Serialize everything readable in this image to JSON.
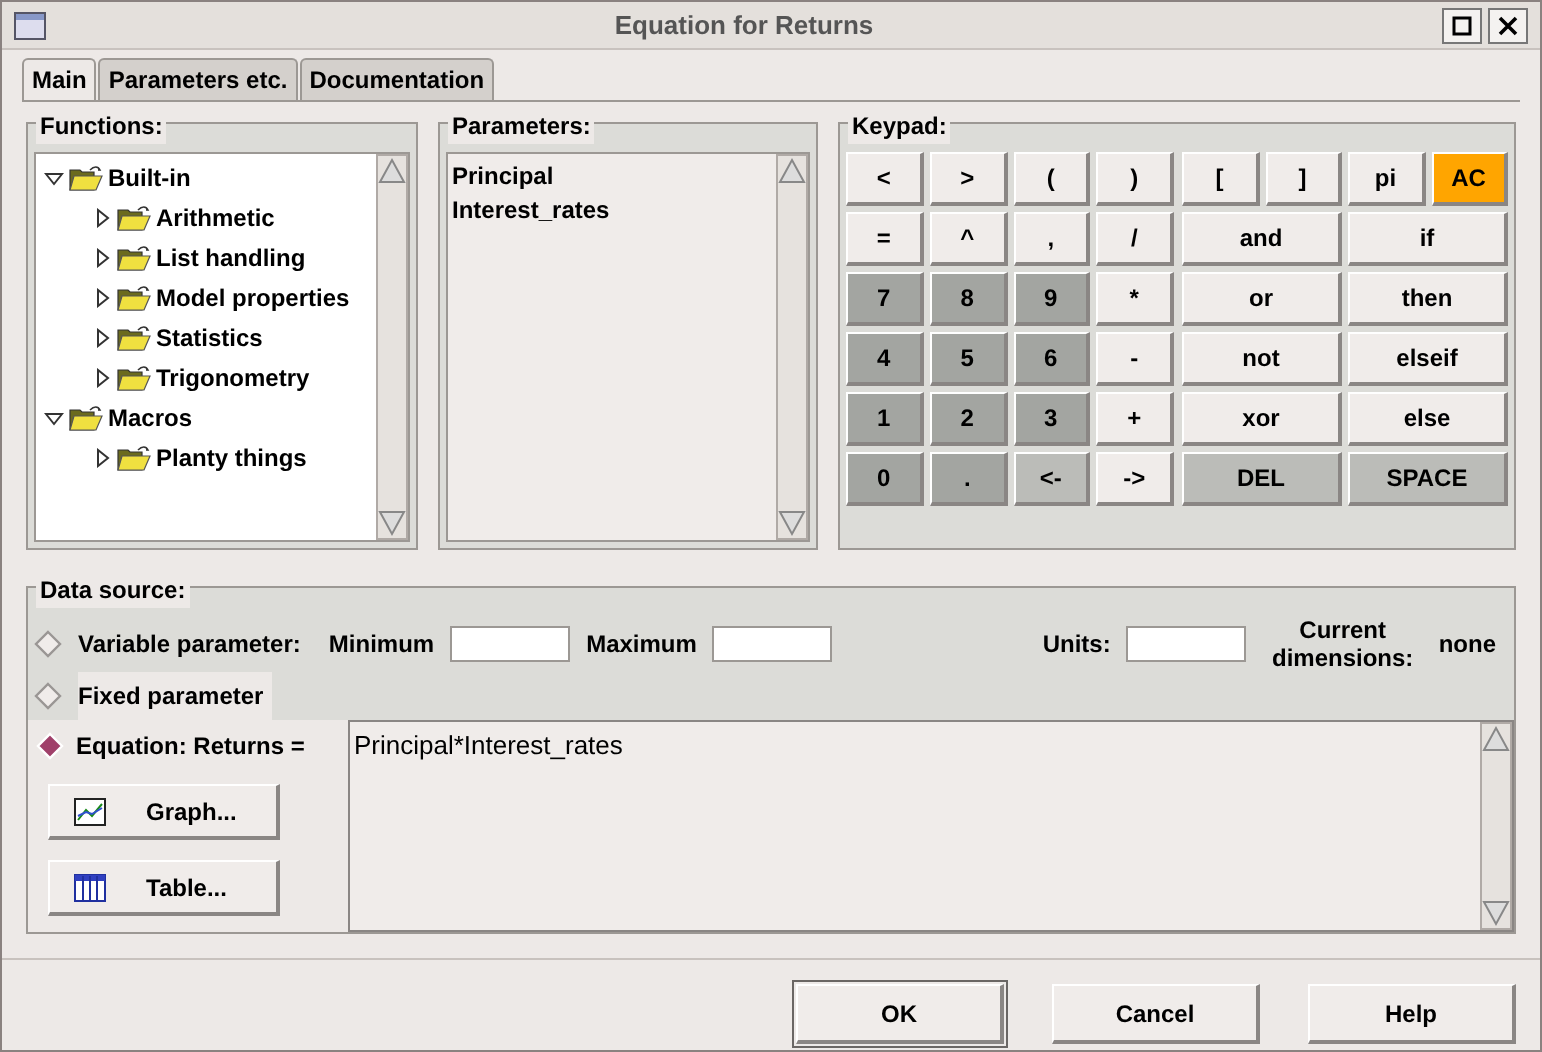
{
  "window": {
    "title": "Equation for Returns"
  },
  "tabs": [
    {
      "label": "Main",
      "selected": true
    },
    {
      "label": "Parameters etc.",
      "selected": false
    },
    {
      "label": "Documentation",
      "selected": false
    }
  ],
  "functions": {
    "title": "Functions:",
    "tree": [
      {
        "label": "Built-in",
        "expanded": true,
        "children": [
          {
            "label": "Arithmetic",
            "expanded": false
          },
          {
            "label": "List handling",
            "expanded": false
          },
          {
            "label": "Model properties",
            "expanded": false
          },
          {
            "label": "Statistics",
            "expanded": false
          },
          {
            "label": "Trigonometry",
            "expanded": false
          }
        ]
      },
      {
        "label": "Macros",
        "expanded": true,
        "children": [
          {
            "label": "Planty things",
            "expanded": false
          }
        ]
      }
    ]
  },
  "parameters": {
    "title": "Parameters:",
    "items": [
      "Principal",
      "Interest_rates"
    ]
  },
  "keypad": {
    "title": "Keypad:",
    "left_keys": [
      {
        "label": "<",
        "kind": "light"
      },
      {
        "label": ">",
        "kind": "light"
      },
      {
        "label": "(",
        "kind": "light"
      },
      {
        "label": ")",
        "kind": "light"
      },
      {
        "label": "=",
        "kind": "light"
      },
      {
        "label": "^",
        "kind": "light"
      },
      {
        "label": ",",
        "kind": "light"
      },
      {
        "label": "/",
        "kind": "light"
      },
      {
        "label": "7",
        "kind": "dark"
      },
      {
        "label": "8",
        "kind": "dark"
      },
      {
        "label": "9",
        "kind": "dark"
      },
      {
        "label": "*",
        "kind": "light"
      },
      {
        "label": "4",
        "kind": "dark"
      },
      {
        "label": "5",
        "kind": "dark"
      },
      {
        "label": "6",
        "kind": "dark"
      },
      {
        "label": "-",
        "kind": "light"
      },
      {
        "label": "1",
        "kind": "dark"
      },
      {
        "label": "2",
        "kind": "dark"
      },
      {
        "label": "3",
        "kind": "dark"
      },
      {
        "label": "+",
        "kind": "light"
      },
      {
        "label": "0",
        "kind": "dark"
      },
      {
        "label": ".",
        "kind": "dark"
      },
      {
        "label": "<-",
        "kind": "mid"
      },
      {
        "label": "->",
        "kind": "light"
      }
    ],
    "top_keys": [
      {
        "label": "[",
        "kind": "light"
      },
      {
        "label": "]",
        "kind": "light"
      },
      {
        "label": "pi",
        "kind": "light"
      },
      {
        "label": "AC",
        "kind": "accent"
      }
    ],
    "wide_keys": [
      {
        "label": "and",
        "kind": "light"
      },
      {
        "label": "if",
        "kind": "light"
      },
      {
        "label": "or",
        "kind": "light"
      },
      {
        "label": "then",
        "kind": "light"
      },
      {
        "label": "not",
        "kind": "light"
      },
      {
        "label": "elseif",
        "kind": "light"
      },
      {
        "label": "xor",
        "kind": "light"
      },
      {
        "label": "else",
        "kind": "light"
      },
      {
        "label": "DEL",
        "kind": "mid"
      },
      {
        "label": "SPACE",
        "kind": "mid"
      }
    ]
  },
  "data_source": {
    "title": "Data source:",
    "variable": {
      "label": "Variable parameter:",
      "selected": false,
      "minimum_label": "Minimum",
      "maximum_label": "Maximum",
      "units_label": "Units:",
      "dimensions_label": "Current dimensions:",
      "dimensions_value": "none"
    },
    "fixed": {
      "label": "Fixed parameter",
      "selected": false
    },
    "equation": {
      "label": "Equation: Returns =",
      "selected": true,
      "value": "Principal*Interest_rates"
    },
    "buttons": [
      {
        "label": "Graph...",
        "kind": "graph"
      },
      {
        "label": "Table...",
        "kind": "table"
      }
    ]
  },
  "buttons": [
    {
      "label": "OK",
      "default": true
    },
    {
      "label": "Cancel",
      "default": false
    },
    {
      "label": "Help",
      "default": false
    }
  ]
}
